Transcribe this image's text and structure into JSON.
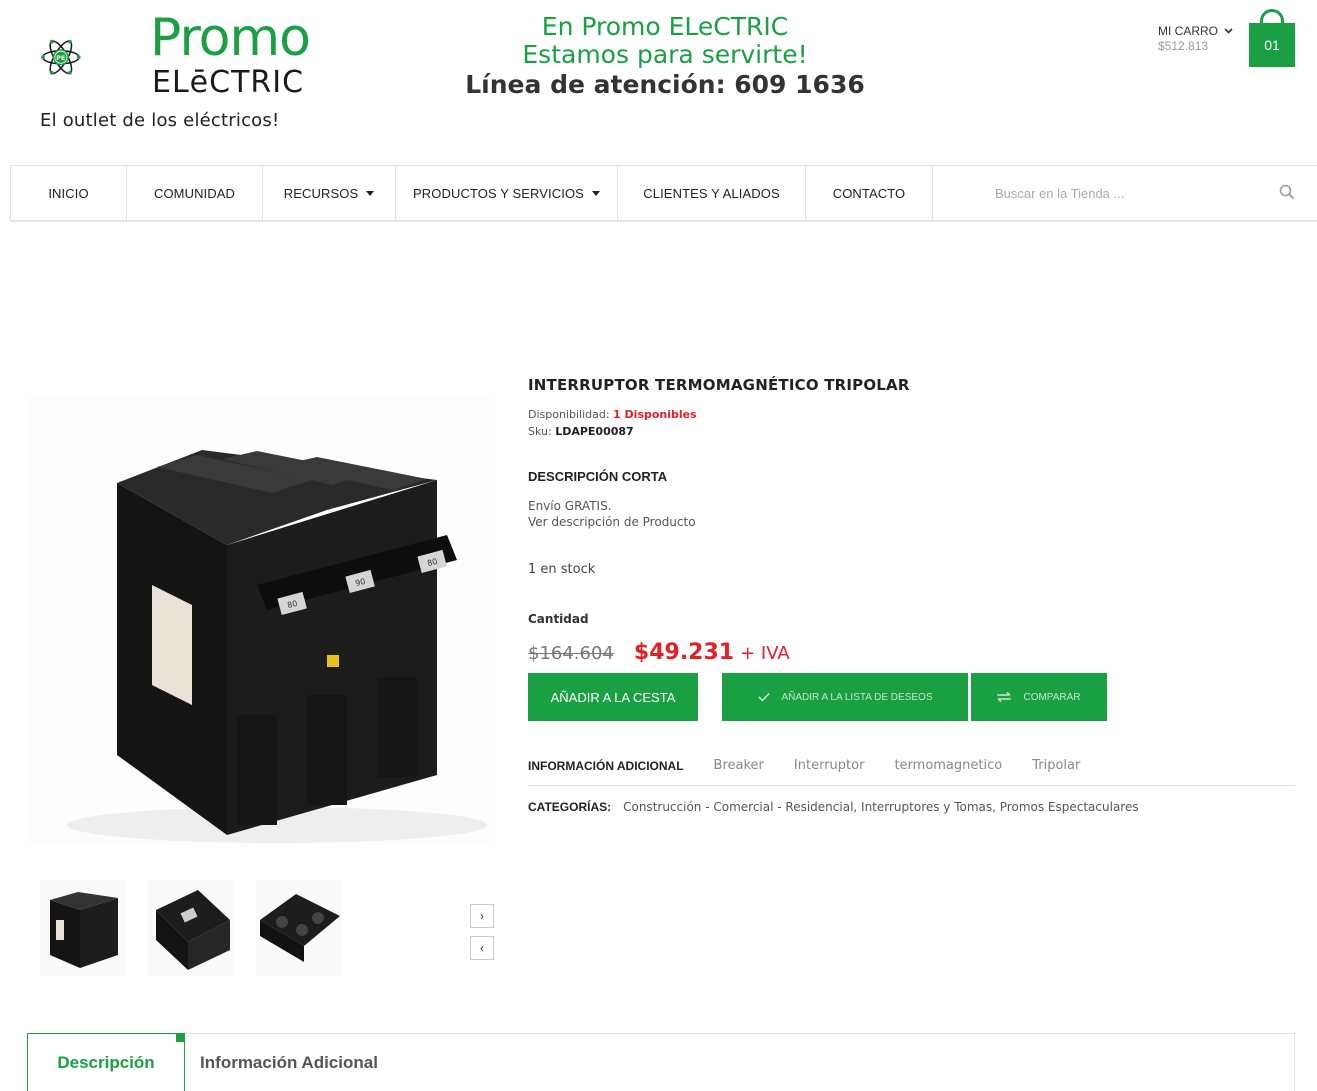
{
  "brand": {
    "name_primary": "Promo",
    "name_secondary": "ELēCTRIC",
    "tagline": "El outlet de los eléctricos!",
    "logo_badge": "PE",
    "accent_color": "#1aa043"
  },
  "header": {
    "line1": "En Promo ELeCTRIC",
    "line2": "Estamos para servirte!",
    "line3": "Línea de atención: 609 1636"
  },
  "cart": {
    "label": "MI CARRO",
    "amount": "$512.813",
    "count": "01",
    "icon": "shopping-bag-icon"
  },
  "nav": {
    "items": [
      {
        "label": "INICIO",
        "has_dropdown": false
      },
      {
        "label": "COMUNIDAD",
        "has_dropdown": false
      },
      {
        "label": "RECURSOS",
        "has_dropdown": true
      },
      {
        "label": "PRODUCTOS Y SERVICIOS",
        "has_dropdown": true
      },
      {
        "label": "CLIENTES Y ALIADOS",
        "has_dropdown": false
      },
      {
        "label": "CONTACTO",
        "has_dropdown": false
      }
    ],
    "search_placeholder": "Buscar en la Tienda ..."
  },
  "product": {
    "title": "INTERRUPTOR TERMOMAGNÉTICO TRIPOLAR",
    "availability_label": "Disponibilidad:",
    "availability_value": "1 Disponibles",
    "sku_label": "Sku:",
    "sku_value": "LDAPE00087",
    "short_desc_heading": "DESCRIPCIÓN CORTA",
    "short_desc_line1": "Envío GRATIS.",
    "short_desc_line2": "Ver descripción de Producto",
    "stock": "1 en stock",
    "quantity_label": "Cantidad",
    "old_price": "$164.604",
    "new_price": "$49.231",
    "tax_suffix": "+ IVA",
    "add_to_cart": "AÑADIR A LA CESTA",
    "add_to_wishlist": "AÑADIR A LA LISTA DE DESEOS",
    "compare": "COMPARAR",
    "tags_heading": "INFORMACIÓN ADICIONAL",
    "tags": [
      "Breaker",
      "Interruptor",
      "termomagnetico",
      "Tripolar"
    ],
    "categories_heading": "CATEGORÍAS:",
    "categories": "Construcción - Comercial - Residencial, Interruptores y Tomas, Promos Espectaculares",
    "breaker_labels": [
      "80",
      "90",
      "80"
    ]
  },
  "gallery": {
    "next": "›",
    "prev": "‹"
  },
  "tabs": {
    "description": "Descripción",
    "additional_info": "Información Adicional"
  }
}
